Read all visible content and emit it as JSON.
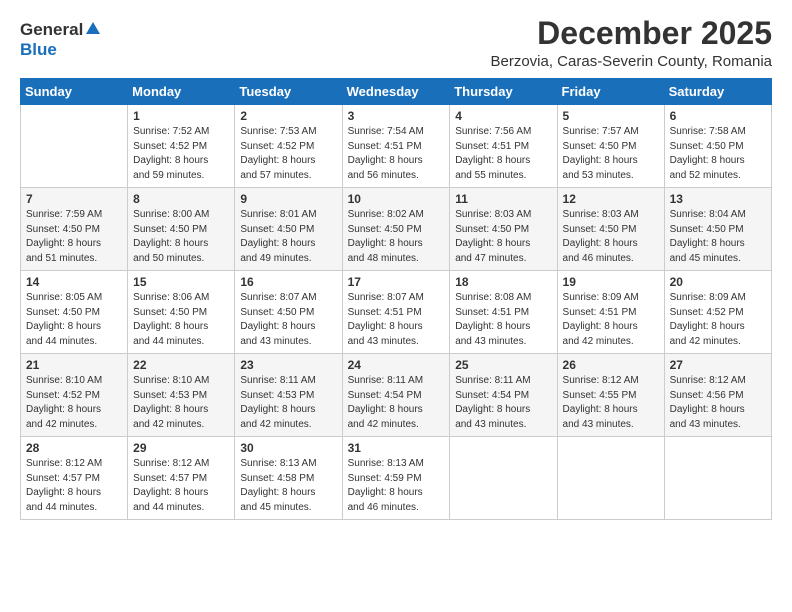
{
  "logo": {
    "general": "General",
    "blue": "Blue"
  },
  "title": "December 2025",
  "subtitle": "Berzovia, Caras-Severin County, Romania",
  "weekdays": [
    "Sunday",
    "Monday",
    "Tuesday",
    "Wednesday",
    "Thursday",
    "Friday",
    "Saturday"
  ],
  "weeks": [
    [
      {
        "day": "",
        "sunrise": "",
        "sunset": "",
        "daylight": ""
      },
      {
        "day": "1",
        "sunrise": "Sunrise: 7:52 AM",
        "sunset": "Sunset: 4:52 PM",
        "daylight": "Daylight: 8 hours and 59 minutes."
      },
      {
        "day": "2",
        "sunrise": "Sunrise: 7:53 AM",
        "sunset": "Sunset: 4:52 PM",
        "daylight": "Daylight: 8 hours and 57 minutes."
      },
      {
        "day": "3",
        "sunrise": "Sunrise: 7:54 AM",
        "sunset": "Sunset: 4:51 PM",
        "daylight": "Daylight: 8 hours and 56 minutes."
      },
      {
        "day": "4",
        "sunrise": "Sunrise: 7:56 AM",
        "sunset": "Sunset: 4:51 PM",
        "daylight": "Daylight: 8 hours and 55 minutes."
      },
      {
        "day": "5",
        "sunrise": "Sunrise: 7:57 AM",
        "sunset": "Sunset: 4:50 PM",
        "daylight": "Daylight: 8 hours and 53 minutes."
      },
      {
        "day": "6",
        "sunrise": "Sunrise: 7:58 AM",
        "sunset": "Sunset: 4:50 PM",
        "daylight": "Daylight: 8 hours and 52 minutes."
      }
    ],
    [
      {
        "day": "7",
        "sunrise": "Sunrise: 7:59 AM",
        "sunset": "Sunset: 4:50 PM",
        "daylight": "Daylight: 8 hours and 51 minutes."
      },
      {
        "day": "8",
        "sunrise": "Sunrise: 8:00 AM",
        "sunset": "Sunset: 4:50 PM",
        "daylight": "Daylight: 8 hours and 50 minutes."
      },
      {
        "day": "9",
        "sunrise": "Sunrise: 8:01 AM",
        "sunset": "Sunset: 4:50 PM",
        "daylight": "Daylight: 8 hours and 49 minutes."
      },
      {
        "day": "10",
        "sunrise": "Sunrise: 8:02 AM",
        "sunset": "Sunset: 4:50 PM",
        "daylight": "Daylight: 8 hours and 48 minutes."
      },
      {
        "day": "11",
        "sunrise": "Sunrise: 8:03 AM",
        "sunset": "Sunset: 4:50 PM",
        "daylight": "Daylight: 8 hours and 47 minutes."
      },
      {
        "day": "12",
        "sunrise": "Sunrise: 8:03 AM",
        "sunset": "Sunset: 4:50 PM",
        "daylight": "Daylight: 8 hours and 46 minutes."
      },
      {
        "day": "13",
        "sunrise": "Sunrise: 8:04 AM",
        "sunset": "Sunset: 4:50 PM",
        "daylight": "Daylight: 8 hours and 45 minutes."
      }
    ],
    [
      {
        "day": "14",
        "sunrise": "Sunrise: 8:05 AM",
        "sunset": "Sunset: 4:50 PM",
        "daylight": "Daylight: 8 hours and 44 minutes."
      },
      {
        "day": "15",
        "sunrise": "Sunrise: 8:06 AM",
        "sunset": "Sunset: 4:50 PM",
        "daylight": "Daylight: 8 hours and 44 minutes."
      },
      {
        "day": "16",
        "sunrise": "Sunrise: 8:07 AM",
        "sunset": "Sunset: 4:50 PM",
        "daylight": "Daylight: 8 hours and 43 minutes."
      },
      {
        "day": "17",
        "sunrise": "Sunrise: 8:07 AM",
        "sunset": "Sunset: 4:51 PM",
        "daylight": "Daylight: 8 hours and 43 minutes."
      },
      {
        "day": "18",
        "sunrise": "Sunrise: 8:08 AM",
        "sunset": "Sunset: 4:51 PM",
        "daylight": "Daylight: 8 hours and 43 minutes."
      },
      {
        "day": "19",
        "sunrise": "Sunrise: 8:09 AM",
        "sunset": "Sunset: 4:51 PM",
        "daylight": "Daylight: 8 hours and 42 minutes."
      },
      {
        "day": "20",
        "sunrise": "Sunrise: 8:09 AM",
        "sunset": "Sunset: 4:52 PM",
        "daylight": "Daylight: 8 hours and 42 minutes."
      }
    ],
    [
      {
        "day": "21",
        "sunrise": "Sunrise: 8:10 AM",
        "sunset": "Sunset: 4:52 PM",
        "daylight": "Daylight: 8 hours and 42 minutes."
      },
      {
        "day": "22",
        "sunrise": "Sunrise: 8:10 AM",
        "sunset": "Sunset: 4:53 PM",
        "daylight": "Daylight: 8 hours and 42 minutes."
      },
      {
        "day": "23",
        "sunrise": "Sunrise: 8:11 AM",
        "sunset": "Sunset: 4:53 PM",
        "daylight": "Daylight: 8 hours and 42 minutes."
      },
      {
        "day": "24",
        "sunrise": "Sunrise: 8:11 AM",
        "sunset": "Sunset: 4:54 PM",
        "daylight": "Daylight: 8 hours and 42 minutes."
      },
      {
        "day": "25",
        "sunrise": "Sunrise: 8:11 AM",
        "sunset": "Sunset: 4:54 PM",
        "daylight": "Daylight: 8 hours and 43 minutes."
      },
      {
        "day": "26",
        "sunrise": "Sunrise: 8:12 AM",
        "sunset": "Sunset: 4:55 PM",
        "daylight": "Daylight: 8 hours and 43 minutes."
      },
      {
        "day": "27",
        "sunrise": "Sunrise: 8:12 AM",
        "sunset": "Sunset: 4:56 PM",
        "daylight": "Daylight: 8 hours and 43 minutes."
      }
    ],
    [
      {
        "day": "28",
        "sunrise": "Sunrise: 8:12 AM",
        "sunset": "Sunset: 4:57 PM",
        "daylight": "Daylight: 8 hours and 44 minutes."
      },
      {
        "day": "29",
        "sunrise": "Sunrise: 8:12 AM",
        "sunset": "Sunset: 4:57 PM",
        "daylight": "Daylight: 8 hours and 44 minutes."
      },
      {
        "day": "30",
        "sunrise": "Sunrise: 8:13 AM",
        "sunset": "Sunset: 4:58 PM",
        "daylight": "Daylight: 8 hours and 45 minutes."
      },
      {
        "day": "31",
        "sunrise": "Sunrise: 8:13 AM",
        "sunset": "Sunset: 4:59 PM",
        "daylight": "Daylight: 8 hours and 46 minutes."
      },
      {
        "day": "",
        "sunrise": "",
        "sunset": "",
        "daylight": ""
      },
      {
        "day": "",
        "sunrise": "",
        "sunset": "",
        "daylight": ""
      },
      {
        "day": "",
        "sunrise": "",
        "sunset": "",
        "daylight": ""
      }
    ]
  ]
}
